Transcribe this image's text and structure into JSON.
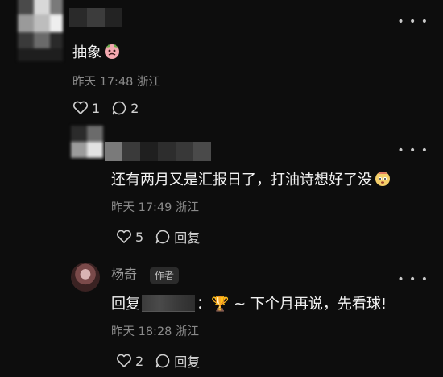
{
  "comments": [
    {
      "text": "抽象",
      "emoji": "face-emoji",
      "meta": "昨天 17:48 浙江",
      "likes": "1",
      "replies": "2"
    },
    {
      "text": "还有两月又是汇报日了，打油诗想好了没",
      "emoji": "face-emoji",
      "meta": "昨天 17:49 浙江",
      "likes": "5",
      "reply_label": "回复"
    },
    {
      "author": "杨奇",
      "badge": "作者",
      "reply_prefix": "回复",
      "text": "：🏆 ~ 下个月再说，先看球!",
      "meta": "昨天 18:28 浙江",
      "likes": "2",
      "reply_label": "回复"
    }
  ],
  "more_icon": "more-dots-icon"
}
